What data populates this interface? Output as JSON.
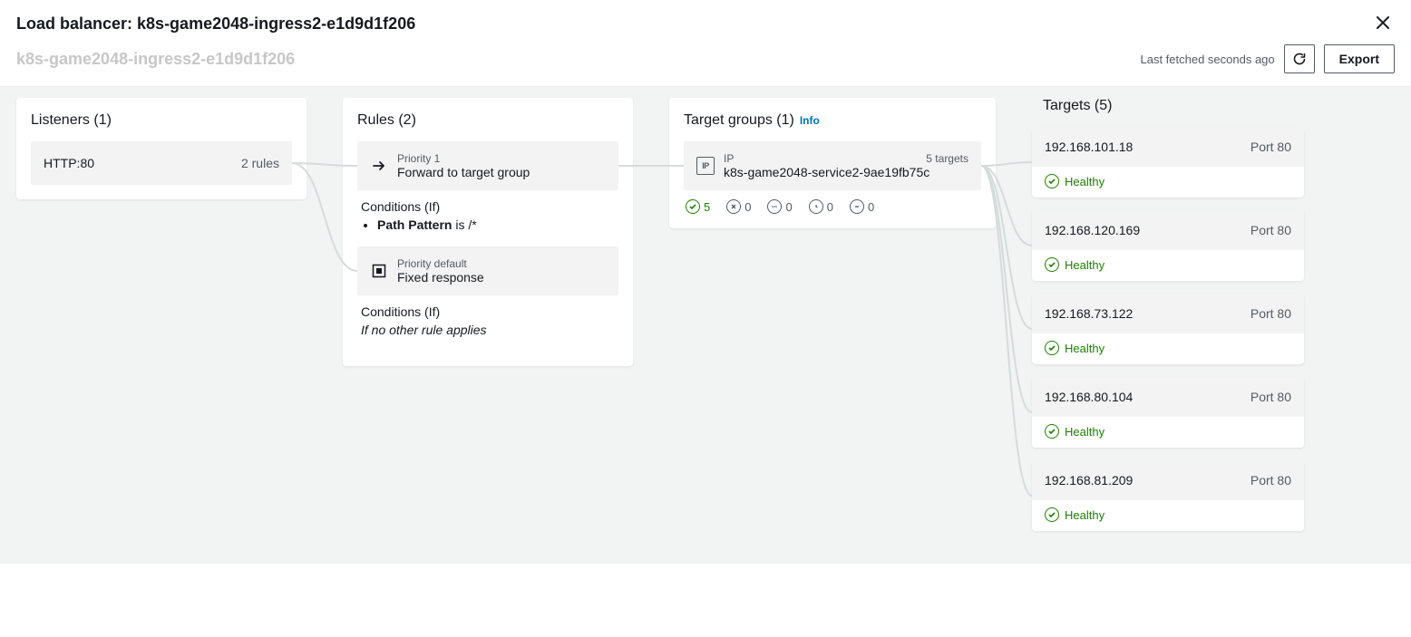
{
  "header": {
    "title_prefix": "Load balancer: ",
    "title_name": "k8s-game2048-ingress2-e1d9d1f206",
    "breadcrumb_ghost": "k8s-game2048-ingress2-e1d9d1f206",
    "last_fetched": "Last fetched seconds ago",
    "export_label": "Export"
  },
  "listeners": {
    "title": "Listeners (1)",
    "items": [
      {
        "label": "HTTP:80",
        "detail": "2 rules"
      }
    ]
  },
  "rules": {
    "title": "Rules (2)",
    "items": [
      {
        "icon": "arrow",
        "line1": "Priority 1",
        "line2": "Forward to target group",
        "conditions_title": "Conditions (If)",
        "conditions_kind": "list",
        "condition_label": "Path Pattern",
        "condition_rest": " is /*"
      },
      {
        "icon": "stop",
        "line1": "Priority default",
        "line2": "Fixed response",
        "conditions_title": "Conditions (If)",
        "conditions_kind": "text",
        "condition_text": "If no other rule applies"
      }
    ]
  },
  "target_groups": {
    "title": "Target groups (1)",
    "info": "Info",
    "items": [
      {
        "type_label": "IP",
        "name": "k8s-game2048-service2-9ae19fb75c",
        "count_label": "5 targets",
        "health": {
          "healthy": "5",
          "unhealthy": "0",
          "initial": "0",
          "draining": "0",
          "unused": "0"
        }
      }
    ]
  },
  "targets": {
    "title": "Targets (5)",
    "items": [
      {
        "ip": "192.168.101.18",
        "port": "Port 80",
        "status": "Healthy"
      },
      {
        "ip": "192.168.120.169",
        "port": "Port 80",
        "status": "Healthy"
      },
      {
        "ip": "192.168.73.122",
        "port": "Port 80",
        "status": "Healthy"
      },
      {
        "ip": "192.168.80.104",
        "port": "Port 80",
        "status": "Healthy"
      },
      {
        "ip": "192.168.81.209",
        "port": "Port 80",
        "status": "Healthy"
      }
    ]
  }
}
